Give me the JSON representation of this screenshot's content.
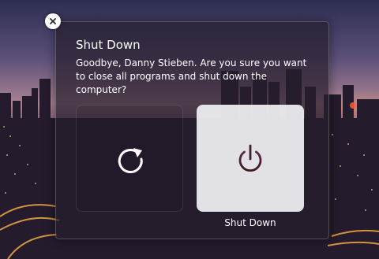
{
  "dialog": {
    "title": "Shut Down",
    "message": "Goodbye, Danny Stieben. Are you sure you want to close all programs and shut down the computer?",
    "close_icon": "close-icon"
  },
  "options": [
    {
      "name": "restart",
      "icon": "restart-icon",
      "label": ""
    },
    {
      "name": "shut-down",
      "icon": "power-icon",
      "label": "Shut Down",
      "selected": true
    }
  ],
  "colors": {
    "highlight": "#f0f0f4",
    "text": "#ffffff",
    "power_gradient_start": "#6a2a4a",
    "power_gradient_end": "#3a1a1a"
  }
}
